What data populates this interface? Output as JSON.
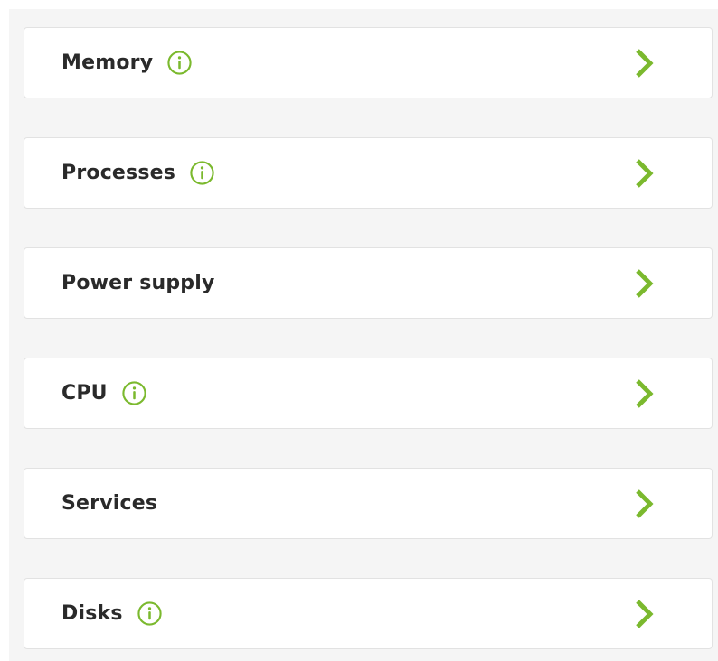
{
  "accent_color": "#7bb92e",
  "items": [
    {
      "label": "Memory",
      "has_info": true,
      "info_icon": "info-icon",
      "chevron_icon": "chevron-right-icon"
    },
    {
      "label": "Processes",
      "has_info": true,
      "info_icon": "info-icon",
      "chevron_icon": "chevron-right-icon"
    },
    {
      "label": "Power supply",
      "has_info": false,
      "chevron_icon": "chevron-right-icon"
    },
    {
      "label": "CPU",
      "has_info": true,
      "info_icon": "info-icon",
      "chevron_icon": "chevron-right-icon"
    },
    {
      "label": "Services",
      "has_info": false,
      "chevron_icon": "chevron-right-icon"
    },
    {
      "label": "Disks",
      "has_info": true,
      "info_icon": "info-icon",
      "chevron_icon": "chevron-right-icon"
    }
  ]
}
